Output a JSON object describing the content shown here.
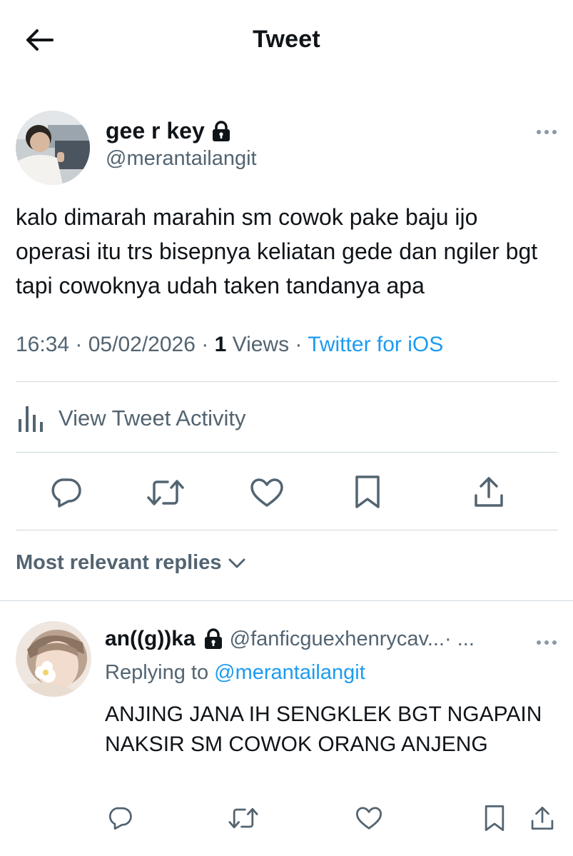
{
  "header": {
    "title": "Tweet",
    "back_icon": "arrow-left-icon"
  },
  "tweet": {
    "author_name": "gee r key",
    "author_handle": "@merantailangit",
    "protected_icon": "lock-icon",
    "text": "kalo dimarah marahin sm cowok pake baju ijo operasi itu trs bisepnya keliatan gede dan ngiler bgt tapi cowoknya udah taken tandanya apa",
    "time": "16:34",
    "date": "05/02/2026",
    "views_count": "1",
    "views_label": "Views",
    "source": "Twitter for iOS",
    "separator": " · "
  },
  "activity": {
    "label": "View Tweet Activity",
    "icon": "bar-chart-icon"
  },
  "actions": [
    "reply-icon",
    "retweet-icon",
    "like-icon",
    "bookmark-icon",
    "share-icon"
  ],
  "replies_sort": {
    "label": "Most relevant replies",
    "icon": "chevron-down-icon"
  },
  "reply": {
    "author_name": "an((g))ka",
    "author_handle": "@fanficguexhenrycav...",
    "suffix": " · ...",
    "replying_prefix": "Replying to",
    "replying_to": "@merantailangit",
    "text": "ANJING JANA IH SENGKLEK BGT NGAPAIN NAKSIR SM COWOK ORANG ANJENG"
  },
  "colors": {
    "accent": "#1d9bf0",
    "text": "#0f1419",
    "muted": "#536471",
    "divider": "#cfd9de"
  }
}
